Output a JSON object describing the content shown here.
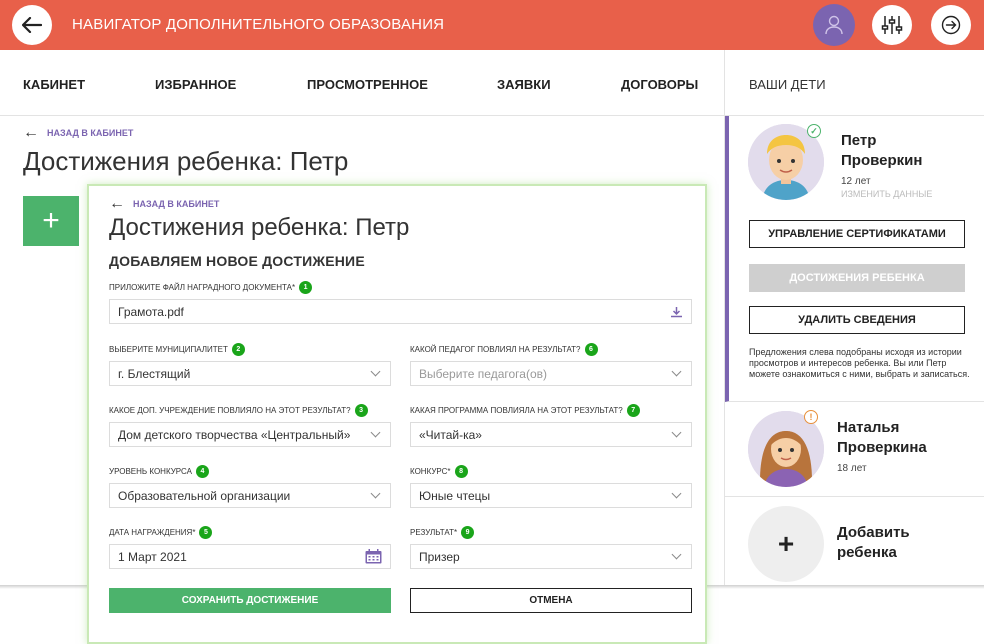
{
  "header": {
    "title": "НАВИГАТОР ДОПОЛНИТЕЛЬНОГО ОБРАЗОВАНИЯ",
    "colors": {
      "brand": "#e8604a",
      "accent": "#7b64b0",
      "success": "#4cb36c"
    }
  },
  "nav": {
    "items": [
      "КАБИНЕТ",
      "ИЗБРАННОЕ",
      "ПРОСМОТРЕННОЕ",
      "ЗАЯВКИ",
      "ДОГОВОРЫ"
    ],
    "right_title": "ВАШИ ДЕТИ"
  },
  "page": {
    "back_label": "НАЗАД В КАБИНЕТ",
    "title": "Достижения ребенка: Петр"
  },
  "form": {
    "back_label": "НАЗАД В КАБИНЕТ",
    "title": "Достижения ребенка: Петр",
    "subtitle": "ДОБАВЛЯЕМ НОВОЕ ДОСТИЖЕНИЕ",
    "file": {
      "label": "ПРИЛОЖИТЕ ФАЙЛ НАГРАДНОГО ДОКУМЕНТА*",
      "badge": "1",
      "value": "Грамота.pdf"
    },
    "municipality": {
      "label": "ВЫБЕРИТЕ МУНИЦИПАЛИТЕТ",
      "badge": "2",
      "value": "г. Блестящий"
    },
    "institution": {
      "label": "КАКОЕ ДОП. УЧРЕЖДЕНИЕ ПОВЛИЯЛО НА ЭТОТ РЕЗУЛЬТАТ?",
      "badge": "3",
      "value": "Дом детского творчества «Центральный»"
    },
    "level": {
      "label": "УРОВЕНЬ КОНКУРСА",
      "badge": "4",
      "value": "Образовательной организации"
    },
    "date": {
      "label": "ДАТА НАГРАЖДЕНИЯ*",
      "badge": "5",
      "value": "1 Март 2021"
    },
    "teacher": {
      "label": "КАКОЙ ПЕДАГОГ ПОВЛИЯЛ НА РЕЗУЛЬТАТ?",
      "badge": "6",
      "placeholder": "Выберите педагога(ов)"
    },
    "program": {
      "label": "КАКАЯ ПРОГРАММА ПОВЛИЯЛА НА ЭТОТ РЕЗУЛЬТАТ?",
      "badge": "7",
      "value": "«Читай-ка»"
    },
    "contest": {
      "label": "КОНКУРС*",
      "badge": "8",
      "value": "Юные чтецы"
    },
    "result": {
      "label": "РЕЗУЛЬТАТ*",
      "badge": "9",
      "value": "Призер"
    },
    "save_label": "СОХРАНИТЬ ДОСТИЖЕНИЕ",
    "cancel_label": "ОТМЕНА"
  },
  "sidebar": {
    "child1": {
      "first_name": "Петр",
      "last_name": "Проверкин",
      "age": "12 лет",
      "edit_label": "ИЗМЕНИТЬ ДАННЫЕ",
      "cert_button": "УПРАВЛЕНИЕ СЕРТИФИКАТАМИ",
      "achievements_button": "ДОСТИЖЕНИЯ РЕБЕНКА",
      "delete_button": "УДАЛИТЬ СВЕДЕНИЯ",
      "note": "Предложения слева подобраны исходя из истории просмотров и интересов ребенка. Вы или Петр можете ознакомиться с ними, выбрать и записаться."
    },
    "child2": {
      "first_name": "Наталья",
      "last_name": "Проверкина",
      "age": "18 лет"
    },
    "add_child": {
      "line1": "Добавить",
      "line2": "ребенка",
      "icon": "+"
    }
  }
}
